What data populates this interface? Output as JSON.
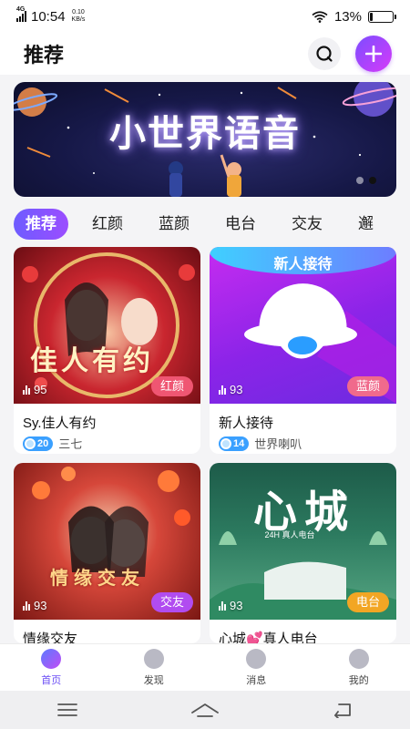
{
  "status_bar": {
    "network_type": "4G",
    "time": "10:54",
    "net_speed_value": "0.10",
    "net_speed_unit": "KB/s",
    "battery": "13%",
    "battery_level": 0.13
  },
  "header": {
    "title": "推荐",
    "search_icon": "search-icon",
    "add_icon": "plus-icon"
  },
  "banner": {
    "title": "小世界语音",
    "page_count": 2,
    "active_page": 2
  },
  "category_tabs": [
    {
      "label": "推荐",
      "active": true
    },
    {
      "label": "红颜",
      "active": false
    },
    {
      "label": "蓝颜",
      "active": false
    },
    {
      "label": "电台",
      "active": false
    },
    {
      "label": "交友",
      "active": false
    },
    {
      "label": "邂",
      "active": false
    }
  ],
  "rooms": [
    {
      "title": "Sy.佳人有约",
      "listeners": "95",
      "tag": "红颜",
      "tag_color": "#ef5672",
      "level": "20",
      "host": "三七",
      "image_text": "佳人有约"
    },
    {
      "title": "新人接待",
      "listeners": "93",
      "tag": "蓝颜",
      "tag_color": "#f06a8c",
      "level": "14",
      "host": "世界喇叭",
      "image_text": "新人接待"
    },
    {
      "title": "情缘交友",
      "listeners": "93",
      "tag": "交友",
      "tag_color": "#b14cf0",
      "level": "",
      "host": "",
      "image_text": "情缘交友"
    },
    {
      "title": "心城💕真人电台",
      "listeners": "93",
      "tag": "电台",
      "tag_color": "#f2a624",
      "level": "",
      "host": "",
      "image_text": "心城",
      "image_subtext": "24H 真人电台"
    }
  ],
  "bottom_nav": [
    {
      "label": "首页",
      "icon": "planet-icon",
      "active": true
    },
    {
      "label": "发现",
      "icon": "discover-icon",
      "active": false
    },
    {
      "label": "消息",
      "icon": "message-icon",
      "active": false
    },
    {
      "label": "我的",
      "icon": "profile-icon",
      "active": false
    }
  ],
  "system_nav": [
    "menu-icon",
    "home-icon",
    "back-icon"
  ]
}
